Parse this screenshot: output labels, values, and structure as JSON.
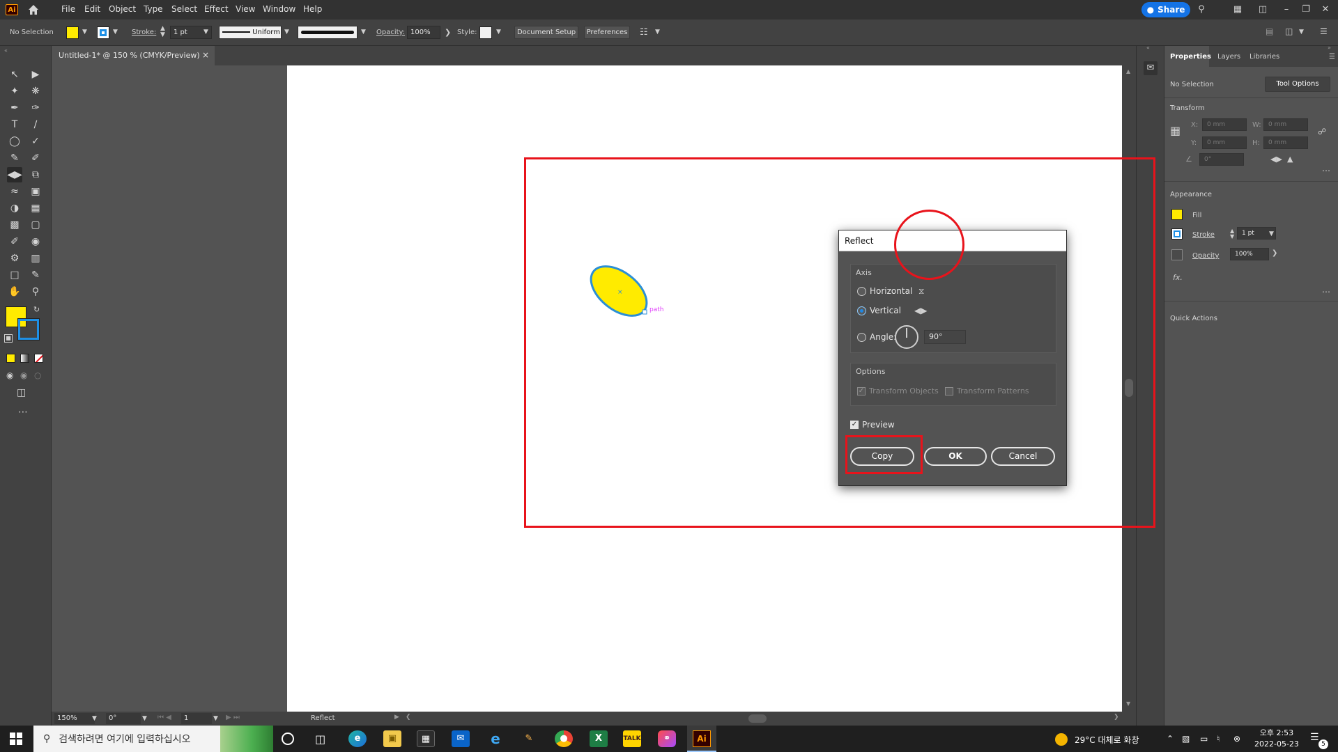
{
  "app": {
    "logo_text": "Ai"
  },
  "menu": {
    "items": [
      "File",
      "Edit",
      "Object",
      "Type",
      "Select",
      "Effect",
      "View",
      "Window",
      "Help"
    ],
    "share_label": "Share"
  },
  "controlbar": {
    "selection": "No Selection",
    "stroke_label": "Stroke:",
    "stroke_value": "1 pt",
    "profile": "Uniform",
    "opacity_label": "Opacity:",
    "opacity_value": "100%",
    "style_label": "Style:",
    "document_setup": "Document Setup",
    "preferences": "Preferences",
    "fill_color": "#ffeb00",
    "stroke_color": "#1e90e6"
  },
  "document": {
    "tab_title": "Untitled-1* @ 150 % (CMYK/Preview)",
    "close_glyph": "×"
  },
  "canvas": {
    "object_label": "path",
    "ellipse_fill": "#ffeb00",
    "ellipse_stroke": "#2b8fd6"
  },
  "statusbar": {
    "zoom": "150%",
    "rotation": "0°",
    "artboard": "1",
    "tool": "Reflect"
  },
  "properties": {
    "tabs": [
      "Properties",
      "Layers",
      "Libraries"
    ],
    "selection": "No Selection",
    "tool_options": "Tool Options",
    "transform_title": "Transform",
    "x_label": "X:",
    "y_label": "Y:",
    "w_label": "W:",
    "h_label": "H:",
    "x_placeholder": "0 mm",
    "y_placeholder": "0 mm",
    "w_placeholder": "0 mm",
    "h_placeholder": "0 mm",
    "angle_placeholder": "0°",
    "appearance_title": "Appearance",
    "fill_label": "Fill",
    "stroke_label": "Stroke",
    "stroke_value": "1 pt",
    "opacity_label": "Opacity",
    "opacity_value": "100%",
    "fx_label": "fx.",
    "quick_actions": "Quick Actions"
  },
  "dialog": {
    "title": "Reflect",
    "axis_label": "Axis",
    "horizontal": "Horizontal",
    "vertical": "Vertical",
    "angle": "Angle:",
    "angle_value": "90°",
    "options_label": "Options",
    "transform_objects": "Transform Objects",
    "transform_patterns": "Transform Patterns",
    "preview": "Preview",
    "copy": "Copy",
    "ok": "OK",
    "cancel": "Cancel",
    "selected_axis": "vertical"
  },
  "annotation_color": "#e8131b",
  "taskbar": {
    "search_placeholder": "검색하려면 여기에 입력하십시오",
    "weather": "29°C  대체로 화창",
    "time": "오후 2:53",
    "date": "2022-05-23",
    "notification_count": "5",
    "apps": [
      "edge",
      "file-explorer",
      "store",
      "mail",
      "internet-explorer",
      "paint",
      "chrome",
      "excel",
      "kakaotalk",
      "creative-cloud",
      "illustrator"
    ]
  }
}
